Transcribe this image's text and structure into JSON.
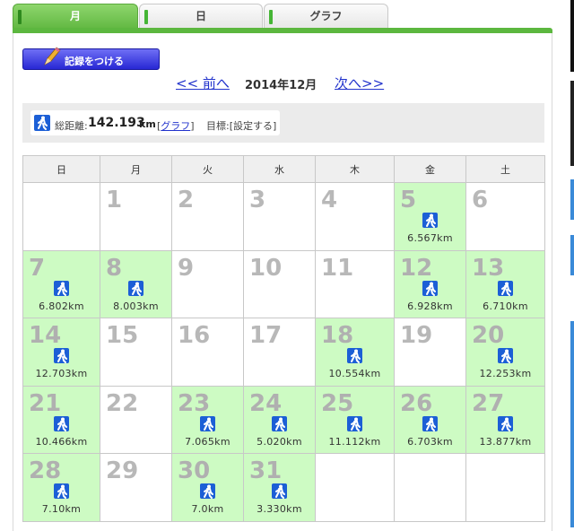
{
  "tabs": [
    {
      "label": "月",
      "active": true
    },
    {
      "label": "日",
      "active": false
    },
    {
      "label": "グラフ",
      "active": false
    }
  ],
  "record_button": {
    "label": "記録をつける"
  },
  "nav": {
    "prev": "<< 前へ",
    "title": "2014年12月",
    "next": "次へ>>"
  },
  "summary": {
    "label": "総距離:",
    "value": "142.193",
    "unit": "km",
    "graph_link": "グラフ",
    "goal_label": "目標:[設定する]"
  },
  "calendar": {
    "weekdays": [
      "日",
      "月",
      "火",
      "水",
      "木",
      "金",
      "土"
    ],
    "weeks": [
      [
        null,
        {
          "day": "1"
        },
        {
          "day": "2"
        },
        {
          "day": "3"
        },
        {
          "day": "4"
        },
        {
          "day": "5",
          "km": "6.567km"
        },
        {
          "day": "6"
        }
      ],
      [
        {
          "day": "7",
          "km": "6.802km"
        },
        {
          "day": "8",
          "km": "8.003km"
        },
        {
          "day": "9"
        },
        {
          "day": "10"
        },
        {
          "day": "11"
        },
        {
          "day": "12",
          "km": "6.928km"
        },
        {
          "day": "13",
          "km": "6.710km"
        }
      ],
      [
        {
          "day": "14",
          "km": "12.703km"
        },
        {
          "day": "15"
        },
        {
          "day": "16"
        },
        {
          "day": "17"
        },
        {
          "day": "18",
          "km": "10.554km"
        },
        {
          "day": "19"
        },
        {
          "day": "20",
          "km": "12.253km"
        }
      ],
      [
        {
          "day": "21",
          "km": "10.466km"
        },
        {
          "day": "22"
        },
        {
          "day": "23",
          "km": "7.065km"
        },
        {
          "day": "24",
          "km": "5.020km"
        },
        {
          "day": "25",
          "km": "11.112km"
        },
        {
          "day": "26",
          "km": "6.703km"
        },
        {
          "day": "27",
          "km": "13.877km"
        }
      ],
      [
        {
          "day": "28",
          "km": "7.10km"
        },
        {
          "day": "29"
        },
        {
          "day": "30",
          "km": "7.0km"
        },
        {
          "day": "31",
          "km": "3.330km"
        },
        null,
        null,
        null
      ]
    ]
  },
  "colors": {
    "active_tab": "#62b842",
    "active_day": "#cdfbc3",
    "link": "#2233cc",
    "icon": "#1c5fd6"
  },
  "icons": {
    "activity": "walking-person-icon",
    "record": "pencil-icon"
  }
}
